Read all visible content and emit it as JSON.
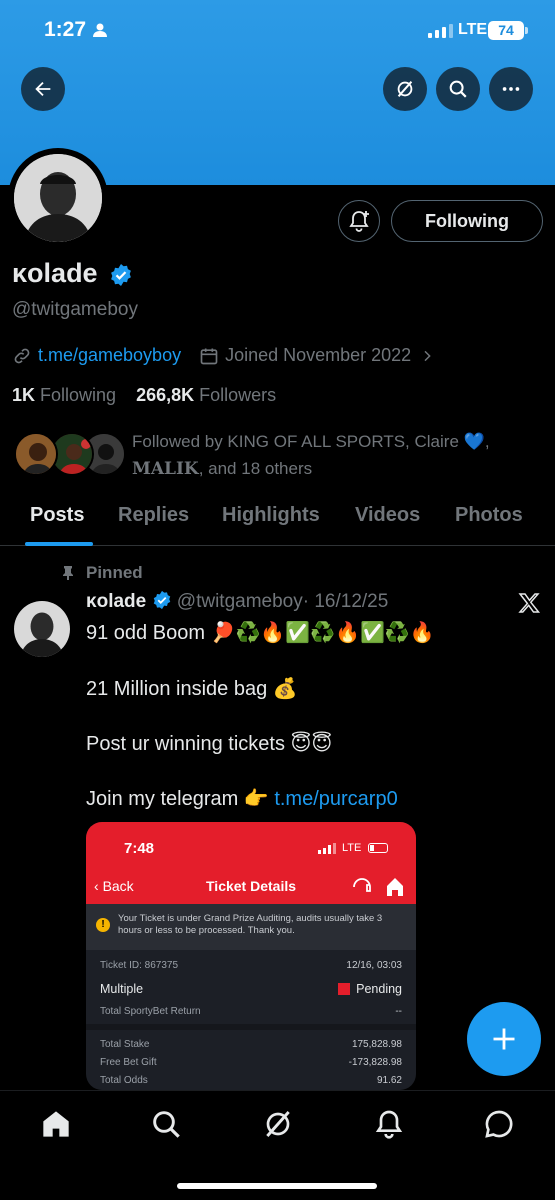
{
  "status_bar": {
    "time": "1:27",
    "network": "LTE",
    "battery": "74"
  },
  "profile": {
    "display_name": "κolade",
    "handle": "@twitgameboy",
    "link": "t.me/gameboyboy",
    "joined": "Joined November 2022",
    "following_count": "1K",
    "following_label": "Following",
    "followers_count": "266,8K",
    "followers_label": "Followers",
    "followed_by_prefix": "Followed by KING OF ALL SPORTS, Claire",
    "followed_by_emoji": "💙",
    "followed_by_suffix": ",",
    "followed_by_malik": "𝐌𝐀𝐋𝐈𝐊",
    "followed_by_others": ", and 18 others",
    "following_button": "Following"
  },
  "tabs": [
    "Posts",
    "Replies",
    "Highlights",
    "Videos",
    "Photos"
  ],
  "post": {
    "pinned_label": "Pinned",
    "author_name": "κolade",
    "author_handle": "@twitgameboy",
    "date": "· 16/12/25",
    "line1": "91 odd Boom",
    "line2": "21 Million inside bag",
    "line3": "Post ur winning tickets",
    "line4": "Join my telegram",
    "line4_link": "t.me/purcarp0",
    "emojis": {
      "line1": "🏓♻️🔥✅♻️🔥✅♻️🔥",
      "line2": "💰",
      "line3": "😇😇",
      "line4": "👉"
    }
  },
  "ticket": {
    "time": "7:48",
    "network": "LTE",
    "back": "Back",
    "title": "Ticket Details",
    "notice": "Your Ticket is under Grand Prize Auditing, audits usually take 3 hours or less to be processed. Thank you.",
    "ticket_id": "Ticket ID: 867375",
    "date": "12/16, 03:03",
    "type": "Multiple",
    "status": "Pending",
    "return_label": "Total SportyBet Return",
    "return_value": "--",
    "stake_label": "Total Stake",
    "stake_value": "175,828.98",
    "gift_label": "Free Bet Gift",
    "gift_value": "-173,828.98",
    "odds_label": "Total Odds",
    "odds_value": "91.62"
  },
  "colors": {
    "accent": "#1d9bf0",
    "banner": "#1d8ddd",
    "ticket_red": "#e41e2b"
  }
}
